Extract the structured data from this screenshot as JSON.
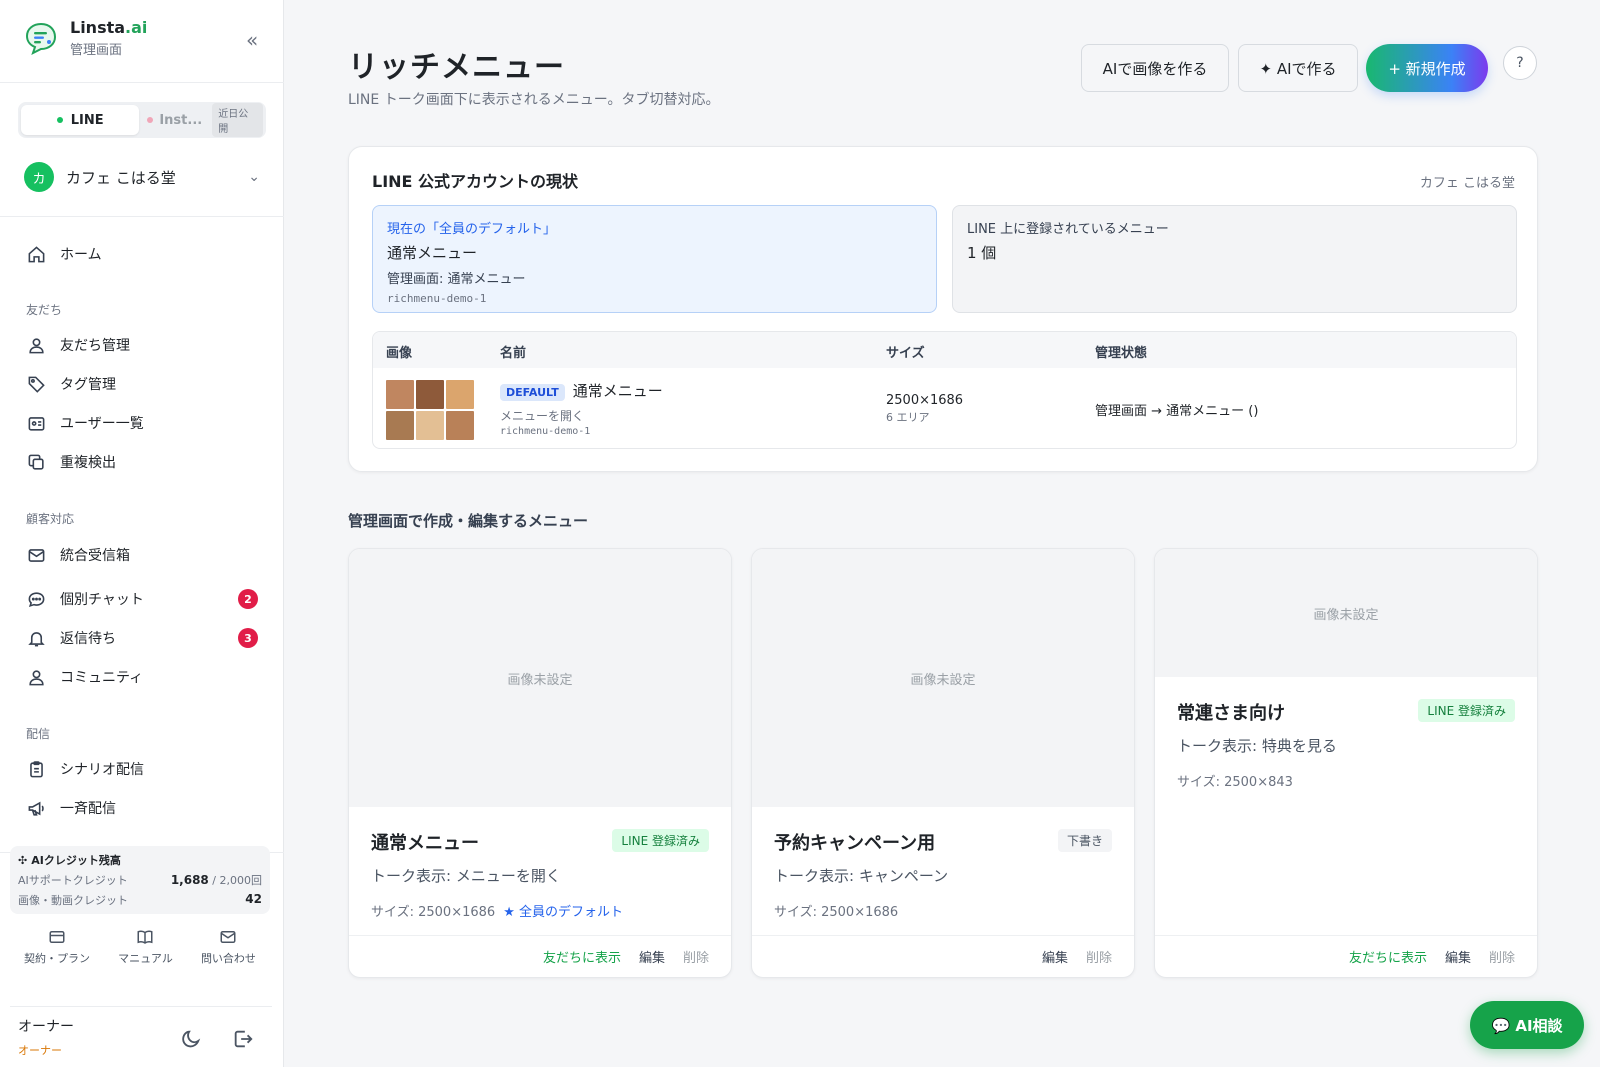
{
  "brand": {
    "name_main": "Linsta",
    "name_suffix": ".ai",
    "subtitle": "管理画面"
  },
  "platform": {
    "line_label": "LINE",
    "inst_label": "Inst...",
    "inst_badge": "近日公開"
  },
  "account": {
    "avatar_char": "カ",
    "name": "カフェ こはる堂"
  },
  "nav": {
    "home": "ホーム",
    "section_friends": "友だち",
    "friends_manage": "友だち管理",
    "tags": "タグ管理",
    "users": "ユーザー一覧",
    "dupes": "重複検出",
    "section_support": "顧客対応",
    "inbox": "統合受信箱",
    "chat": "個別チャット",
    "chat_badge": "2",
    "waiting": "返信待ち",
    "waiting_badge": "3",
    "community": "コミュニティ",
    "section_delivery": "配信",
    "scenario": "シナリオ配信",
    "broadcast": "一斉配信"
  },
  "credits": {
    "title": "AIクレジット残高",
    "support_label": "AIサポートクレジット",
    "support_value": "1,688",
    "support_total": "/ 2,000回",
    "media_label": "画像・動画クレジット",
    "media_value": "42"
  },
  "footer": {
    "plan": "契約・プラン",
    "manual": "マニュアル",
    "contact": "問い合わせ"
  },
  "owner": {
    "name": "オーナー",
    "role": "オーナー"
  },
  "header": {
    "title": "リッチメニュー",
    "subtitle": "LINE トーク画面下に表示されるメニュー。タブ切替対応。",
    "btn_ai_image": "AIで画像を作る",
    "btn_ai_make": "✦ AIで作る",
    "btn_new": "+ 新規作成",
    "help": "?"
  },
  "status": {
    "title": "LINE 公式アカウントの現状",
    "account": "カフェ こはる堂",
    "default_label": "現在の「全員のデフォルト」",
    "default_name": "通常メニュー",
    "default_admin": "管理画面: 通常メニュー",
    "default_id": "richmenu-demo-1",
    "registered_label": "LINE 上に登録されているメニュー",
    "registered_count": "1 個",
    "table": {
      "headers": [
        "画像",
        "名前",
        "サイズ",
        "管理状態"
      ],
      "rows": [
        {
          "badge": "DEFAULT",
          "name": "通常メニュー",
          "chat_bar": "メニューを開く",
          "id": "richmenu-demo-1",
          "size": "2500×1686",
          "areas": "6 エリア",
          "state": "管理画面 → 通常メニュー ()"
        }
      ],
      "thumb_colors": [
        "#c08660",
        "#8e5a3a",
        "#dba56d",
        "#a87a52",
        "#e3bf94",
        "#b98158"
      ]
    }
  },
  "section_title": "管理画面で作成・編集するメニュー",
  "cards": [
    {
      "image": "画像未設定",
      "name": "通常メニュー",
      "status": "LINE 登録済み",
      "talk": "トーク表示: メニューを開く",
      "size": "サイズ: 2500×1686",
      "default_tag": "★ 全員のデフォルト",
      "show": "友だちに表示",
      "edit": "編集",
      "delete": "削除"
    },
    {
      "image": "画像未設定",
      "name": "予約キャンペーン用",
      "status": "下書き",
      "talk": "トーク表示: キャンペーン",
      "size": "サイズ: 2500×1686",
      "edit": "編集",
      "delete": "削除"
    },
    {
      "image": "画像未設定",
      "name": "常連さま向け",
      "status": "LINE 登録済み",
      "talk": "トーク表示: 特典を見る",
      "size": "サイズ: 2500×843",
      "show": "友だちに表示",
      "edit": "編集",
      "delete": "削除"
    }
  ],
  "ai_chat": "💬 AI相談"
}
